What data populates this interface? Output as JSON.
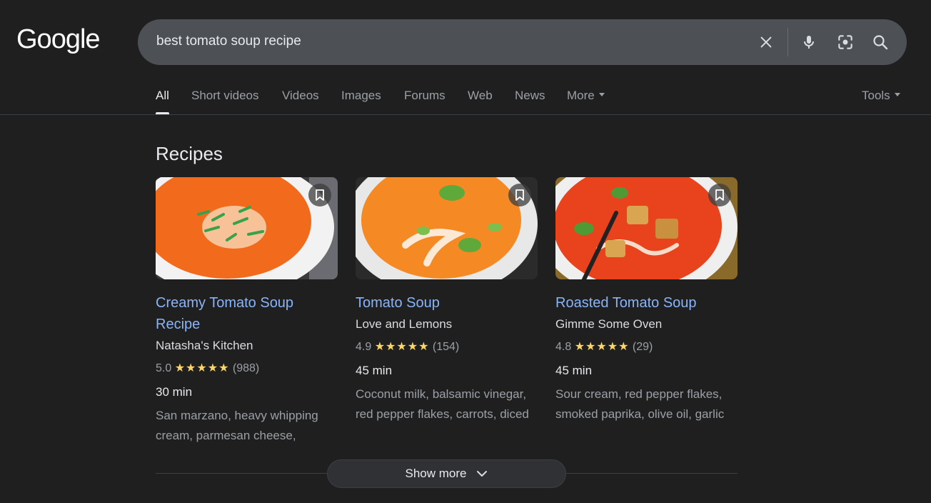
{
  "brand": {
    "logo": "Google"
  },
  "search": {
    "query": "best tomato soup recipe"
  },
  "tabs": [
    {
      "label": "All",
      "active": true
    },
    {
      "label": "Short videos"
    },
    {
      "label": "Videos"
    },
    {
      "label": "Images"
    },
    {
      "label": "Forums"
    },
    {
      "label": "Web"
    },
    {
      "label": "News"
    },
    {
      "label": "More"
    }
  ],
  "tools_label": "Tools",
  "section": {
    "title": "Recipes"
  },
  "recipes": [
    {
      "title_line1": "Creamy Tomato Soup",
      "title_line2": "Recipe",
      "source": "Natasha's Kitchen",
      "rating": "5.0",
      "stars": "★★★★★",
      "reviews": "(988)",
      "time": "30 min",
      "ingredients_line1": "San marzano, heavy whipping",
      "ingredients_line2": "cream, parmesan cheese,"
    },
    {
      "title_line1": "Tomato Soup",
      "source": "Love and Lemons",
      "rating": "4.9",
      "stars": "★★★★★",
      "reviews": "(154)",
      "time": "45 min",
      "ingredients_line1": "Coconut milk, balsamic vinegar,",
      "ingredients_line2": "red pepper flakes, carrots, diced"
    },
    {
      "title_line1": "Roasted Tomato Soup",
      "source": "Gimme Some Oven",
      "rating": "4.8",
      "stars": "★★★★★",
      "reviews": "(29)",
      "time": "45 min",
      "ingredients_line1": "Sour cream, red pepper flakes,",
      "ingredients_line2": "smoked paprika, olive oil, garlic"
    }
  ],
  "show_more_label": "Show more",
  "colors": {
    "link": "#8ab4f8",
    "star": "#fdd663",
    "background": "#1f1f1f",
    "searchbar": "#4d5156"
  }
}
